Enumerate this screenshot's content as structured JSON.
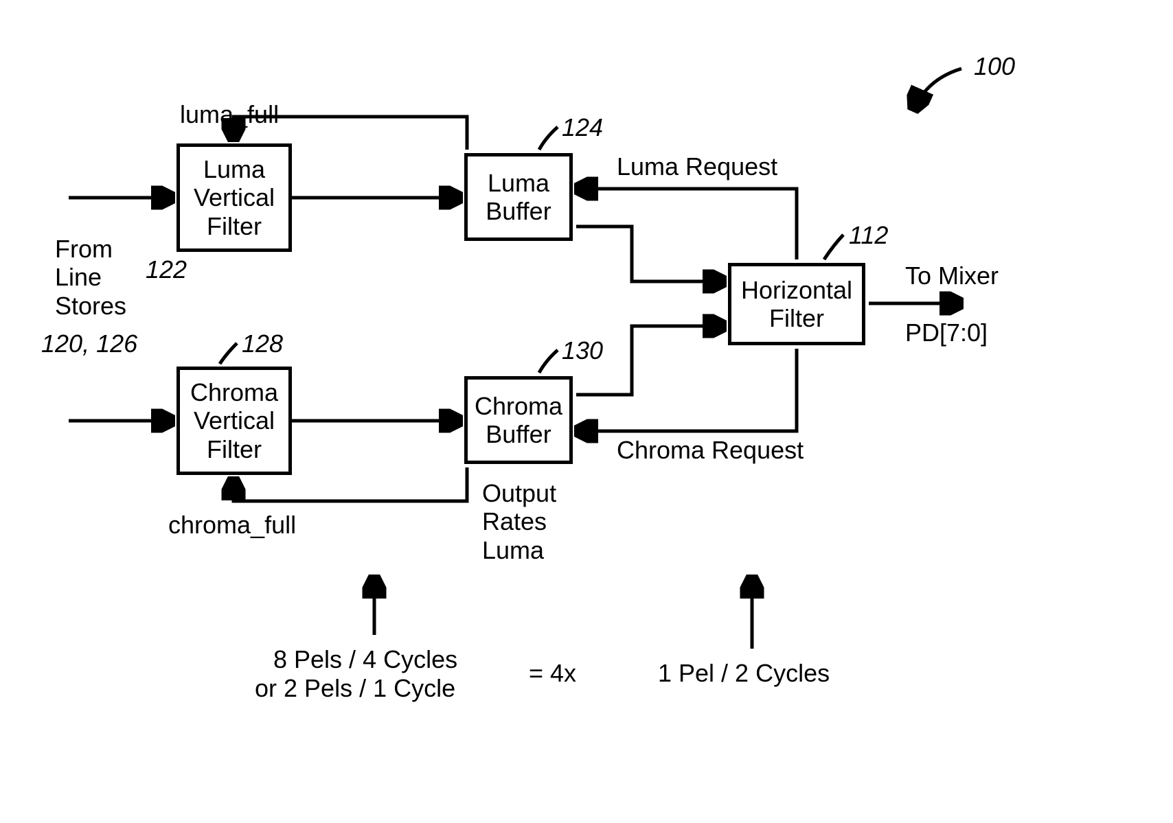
{
  "diagram": {
    "ref_main": "100",
    "input_label": "From\nLine\nStores",
    "input_refs": "120, 126",
    "boxes": {
      "luma_filter": {
        "label": "Luma\nVertical\nFilter",
        "ref": "122"
      },
      "luma_buffer": {
        "label": "Luma\nBuffer",
        "ref": "124"
      },
      "chroma_filter": {
        "label": "Chroma\nVertical\nFilter",
        "ref": "128"
      },
      "chroma_buffer": {
        "label": "Chroma\nBuffer",
        "ref": "130"
      },
      "horizontal_filter": {
        "label": "Horizontal\nFilter",
        "ref": "112"
      }
    },
    "signals": {
      "luma_full": "luma_full",
      "chroma_full": "chroma_full",
      "luma_request": "Luma Request",
      "chroma_request": "Chroma Request"
    },
    "output": {
      "to_mixer": "To Mixer",
      "pd": "PD[7:0]"
    },
    "rates": {
      "heading": "Output\nRates\nLuma",
      "left_line1": "8 Pels / 4 Cycles",
      "left_line2": "or 2 Pels / 1 Cycle",
      "equals": "= 4x",
      "right": "1 Pel / 2 Cycles"
    }
  }
}
